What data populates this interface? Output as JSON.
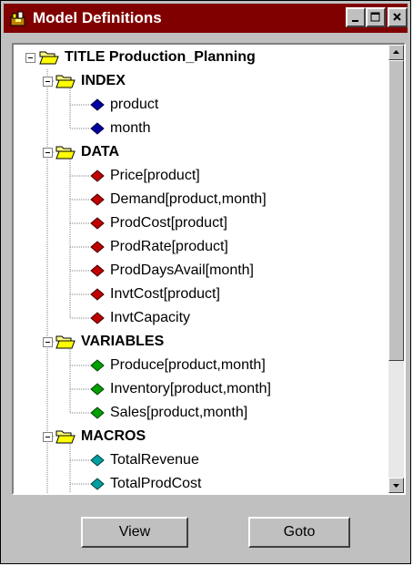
{
  "window": {
    "title": "Model Definitions",
    "titlebar_color": "#800000",
    "controls": [
      "minimize-icon",
      "maximize-icon",
      "close-icon"
    ]
  },
  "tree": {
    "root": {
      "label": "TITLE Production_Planning",
      "icon": "folder-open-icon",
      "expanded": true
    },
    "groups": [
      {
        "label": "INDEX",
        "icon": "folder-open-icon",
        "item_color": "#0000a0",
        "items": [
          "product",
          "month"
        ]
      },
      {
        "label": "DATA",
        "icon": "folder-open-icon",
        "item_color": "#c00000",
        "items": [
          "Price[product]",
          "Demand[product,month]",
          "ProdCost[product]",
          "ProdRate[product]",
          "ProdDaysAvail[month]",
          "InvtCost[product]",
          "InvtCapacity"
        ]
      },
      {
        "label": "VARIABLES",
        "icon": "folder-open-icon",
        "item_color": "#00a000",
        "items": [
          "Produce[product,month]",
          "Inventory[product,month]",
          "Sales[product,month]"
        ]
      },
      {
        "label": "MACROS",
        "icon": "folder-open-icon",
        "item_color": "#00a0a0",
        "items": [
          "TotalRevenue",
          "TotalProdCost"
        ]
      }
    ]
  },
  "buttons": {
    "view": "View",
    "goto": "Goto"
  }
}
